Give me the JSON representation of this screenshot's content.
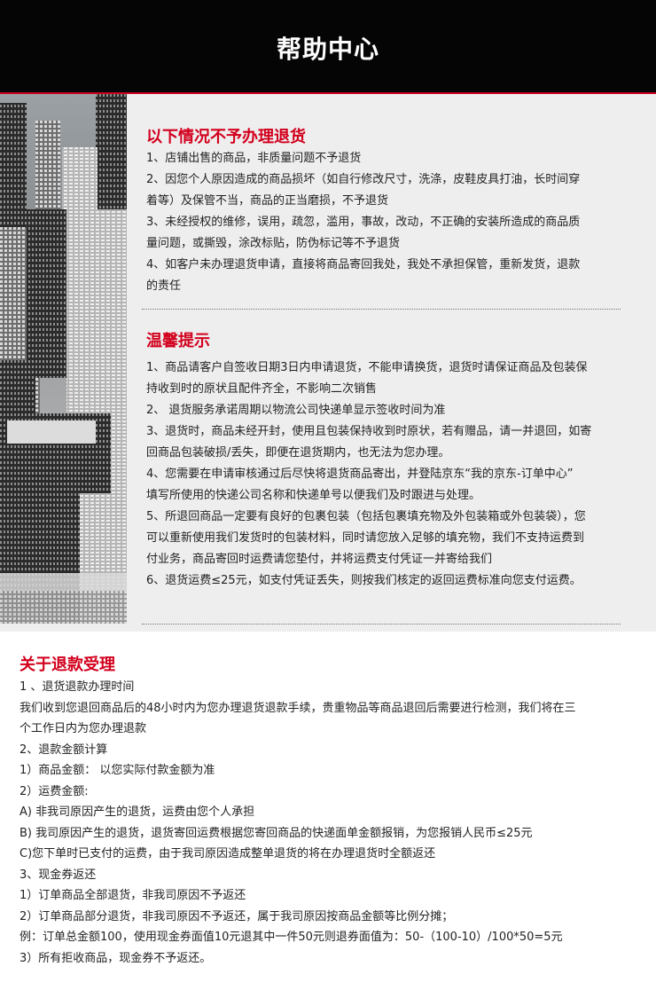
{
  "header": {
    "title": "帮助中心"
  },
  "sec1": {
    "heading": "以下情况不予办理退货",
    "lines": [
      "1、店铺出售的商品，非质量问题不予退货",
      "2、因您个人原因造成的商品损坏（如自行修改尺寸，洗涤，皮鞋皮具打油，长时间穿",
      "着等）及保管不当，商品的正当磨损，不予退货",
      "3、未经授权的维修，误用，疏忽，滥用，事故，改动，不正确的安装所造成的商品质",
      "量问题，或撕毁，涂改标贴，防伪标记等不予退货",
      "4、如客户未办理退货申请，直接将商品寄回我处，我处不承担保管，重新发货，退款",
      "的责任"
    ]
  },
  "sec2": {
    "heading": "温馨提示",
    "lines": [
      "1、商品请客户自签收日期3日内申请退货，不能申请换货，退货时请保证商品及包装保",
      "持收到时的原状且配件齐全，不影响二次销售",
      "2、 退货服务承诺周期以物流公司快递单显示签收时间为准",
      "3、退货时，商品未经开封，使用且包装保持收到时原状，若有赠品，请一并退回，如寄",
      "回商品包装破损/丢失，即便在退货期内，也无法为您办理。",
      "4、您需要在申请审核通过后尽快将退货商品寄出，并登陆京东“我的京东-订单中心”",
      "填写所使用的快递公司名称和快递单号以便我们及时跟进与处理。",
      "5、所退回商品一定要有良好的包裹包装（包括包裹填充物及外包装箱或外包装袋），您",
      "可以重新使用我们发货时的包装材料，同时请您放入足够的填充物，我们不支持运费到",
      "付业务，商品寄回时运费请您垫付，并将运费支付凭证一并寄给我们",
      "6、退货运费≤25元，如支付凭证丢失，则按我们核定的返回运费标准向您支付运费。"
    ]
  },
  "sec3": {
    "heading": "关于退款受理",
    "lines": [
      "1 、退货退款办理时间",
      "我们收到您退回商品后的48小时内为您办理退货退款手续，贵重物品等商品退回后需要进行检测，我们将在三",
      "个工作日内为您办理退款",
      "2、退款金额计算",
      "1）商品金额： 以您实际付款金额为准",
      "2）运费金额:",
      "A) 非我司原因产生的退货，运费由您个人承担",
      "B) 我司原因产生的退货，退货寄回运费根据您寄回商品的快递面单金额报销，为您报销人民币≤25元",
      "C)您下单时已支付的运费，由于我司原因造成整单退货的将在办理退货时全额返还",
      "3、现金券返还",
      "1）订单商品全部退货，非我司原因不予返还",
      "2）订单商品部分退货，非我司原因不予返还，属于我司原因按商品金额等比例分摊；",
      "例：订单总金额100，使用现金券面值10元退其中一件50元则退券面值为：50-（100-10）/100*50=5元",
      "3）所有拒收商品，现金券不予返还。"
    ]
  }
}
